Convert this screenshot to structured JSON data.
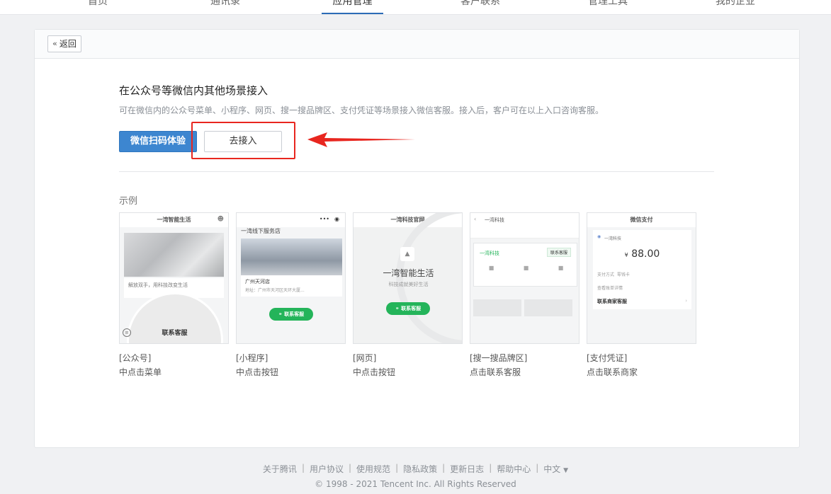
{
  "nav": {
    "items": [
      {
        "label": "首页"
      },
      {
        "label": "通讯录"
      },
      {
        "label": "应用管理"
      },
      {
        "label": "客户联系"
      },
      {
        "label": "管理工具"
      },
      {
        "label": "我的企业"
      }
    ],
    "active": "应用管理",
    "accent_color": "#2b6bb6"
  },
  "panel": {
    "back_label": "返回",
    "title": "在公众号等微信内其他场景接入",
    "description": "可在微信内的公众号菜单、小程序、网页、搜一搜品牌区、支付凭证等场景接入微信客服。接入后，客户可在以上入口咨询客服。",
    "primary_button": "微信扫码体验",
    "secondary_button": "去接入",
    "examples_label": "示例",
    "examples": [
      {
        "caption1": "[公众号]",
        "caption2": "中点击菜单",
        "thumb_title": "一湾智能生活",
        "thumb_button": "联系客服",
        "thumb_text": "解放双手，用科技改变生活"
      },
      {
        "caption1": "[小程序]",
        "caption2": "中点击按钮",
        "thumb_title": "一湾线下服务店",
        "thumb_store": "广州天河店",
        "thumb_addr": "地址：广州市天河区天环大厦...",
        "thumb_button": "联系客服"
      },
      {
        "caption1": "[网页]",
        "caption2": "中点击按钮",
        "thumb_title": "一湾科技官网",
        "thumb_brand": "一湾智能生活",
        "thumb_slogan": "科技成就美好生活",
        "thumb_button": "联系客服"
      },
      {
        "caption1": "[搜一搜品牌区]",
        "caption2": "点击联系客服",
        "thumb_title": "一湾科技",
        "thumb_brand": "一湾科技",
        "thumb_button": "联系客服"
      },
      {
        "caption1": "[支付凭证]",
        "caption2": "点击联系商家",
        "thumb_title": "微信支付",
        "thumb_merchant": "一湾科技",
        "thumb_amount": "88.00",
        "thumb_currency": "¥",
        "thumb_row1": "支付方式",
        "thumb_row1_value": "零钱卡",
        "thumb_row2": "查看账单详情",
        "thumb_row3": "联系商家客服"
      }
    ]
  },
  "footer": {
    "links": [
      "关于腾讯",
      "用户协议",
      "使用规范",
      "隐私政策",
      "更新日志",
      "帮助中心",
      "中文"
    ],
    "lang_caret": "▼",
    "copyright": "© 1998 - 2021 Tencent Inc. All Rights Reserved"
  },
  "colors": {
    "primary": "#3d86d0",
    "annotation_red": "#e8261f",
    "wechat_green": "#24b45a"
  }
}
